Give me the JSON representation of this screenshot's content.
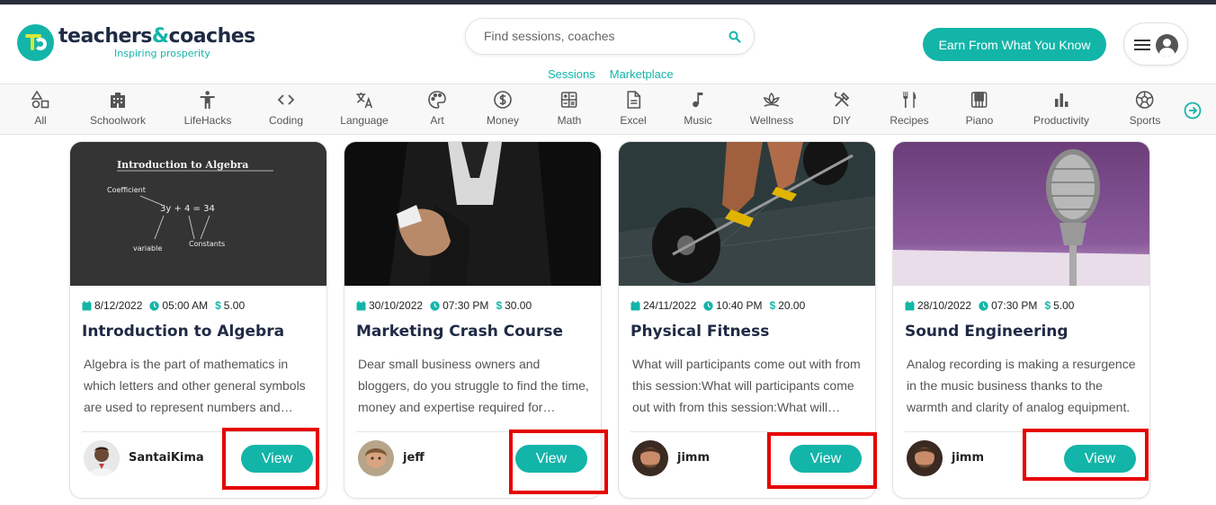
{
  "brand": {
    "name_part1": "teachers",
    "name_amp": "&",
    "name_part2": "coaches",
    "tagline": "Inspiring prosperity",
    "accent": "#13b5a8"
  },
  "search": {
    "placeholder": "Find sessions, coaches",
    "icon": "search-icon"
  },
  "header_links": [
    "Sessions",
    "Marketplace"
  ],
  "earn_button": "Earn From What You Know",
  "categories": [
    {
      "label": "All",
      "icon": "shapes-icon"
    },
    {
      "label": "Schoolwork",
      "icon": "school-icon"
    },
    {
      "label": "LifeHacks",
      "icon": "person-icon"
    },
    {
      "label": "Coding",
      "icon": "code-icon"
    },
    {
      "label": "Language",
      "icon": "translate-icon"
    },
    {
      "label": "Art",
      "icon": "palette-icon"
    },
    {
      "label": "Money",
      "icon": "dollar-icon"
    },
    {
      "label": "Math",
      "icon": "calculator-icon"
    },
    {
      "label": "Excel",
      "icon": "document-icon"
    },
    {
      "label": "Music",
      "icon": "music-note-icon"
    },
    {
      "label": "Wellness",
      "icon": "lotus-icon"
    },
    {
      "label": "DIY",
      "icon": "tools-icon"
    },
    {
      "label": "Recipes",
      "icon": "utensils-icon"
    },
    {
      "label": "Piano",
      "icon": "piano-icon"
    },
    {
      "label": "Productivity",
      "icon": "bar-chart-icon"
    },
    {
      "label": "Sports",
      "icon": "soccer-ball-icon"
    }
  ],
  "cards": [
    {
      "date": "8/12/2022",
      "time": "05:00 AM",
      "price": "5.00",
      "title": "Introduction to Algebra",
      "description": "Algebra is the part of mathematics in which letters and other general symbols are used to represent numbers and quantities in formulae and equations.",
      "author": "SantaiKima",
      "button": "View",
      "image_text": {
        "heading": "Introduction to Algebra",
        "coef": "Coefficient",
        "eq": "3y + 4 = 34",
        "var": "variable",
        "const": "Constants"
      }
    },
    {
      "date": "30/10/2022",
      "time": "07:30 PM",
      "price": "30.00",
      "title": "Marketing Crash Course",
      "description": "Dear small business owners and bloggers, do you struggle to find the time, money and expertise required for marketing?",
      "author": "jeff",
      "button": "View"
    },
    {
      "date": "24/11/2022",
      "time": "10:40 PM",
      "price": "20.00",
      "title": "Physical Fitness",
      "description": "What will participants come out with from this session:What will participants come out with from this session:What will participants",
      "author": "jimm",
      "button": "View"
    },
    {
      "date": "28/10/2022",
      "time": "07:30 PM",
      "price": "5.00",
      "title": "Sound Engineering",
      "description": "Analog recording is making a resurgence in the music business thanks to the warmth and clarity of analog equipment.",
      "author": "jimm",
      "button": "View"
    }
  ]
}
